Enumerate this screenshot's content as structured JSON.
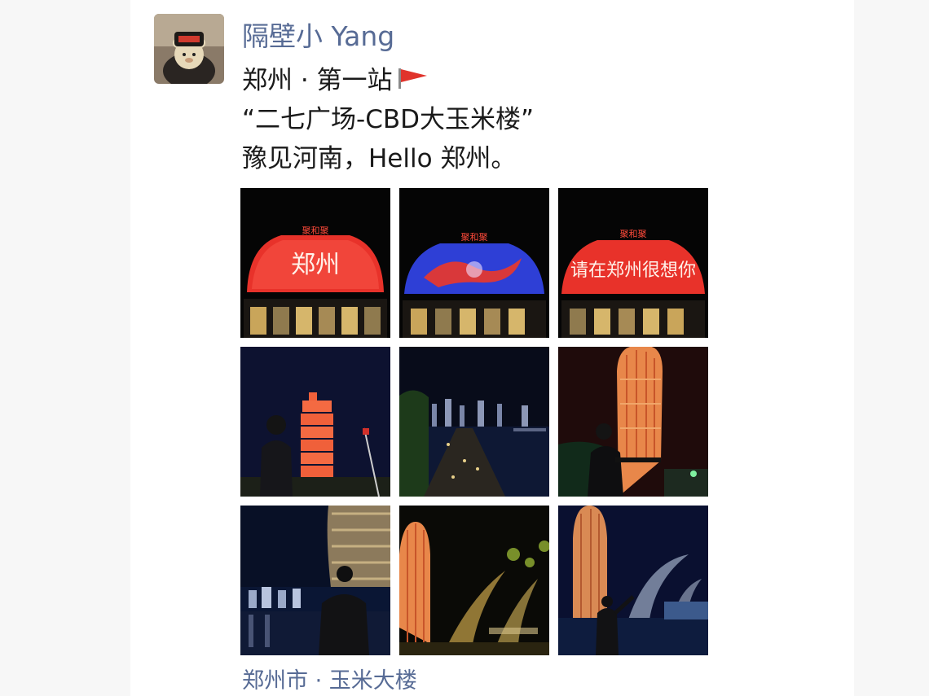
{
  "post": {
    "username": "隔壁小 Yang",
    "text_lines": [
      "郑州 · 第一站",
      "“二七广场-CBD大玉米楼”",
      "豫见河南，Hello 郑州。"
    ],
    "location": "郑州市 · 玉米大楼"
  },
  "photos": [
    {
      "screen_text": "郑州",
      "top_text": "聚和聚"
    },
    {
      "screen_text": "",
      "top_text": "聚和聚"
    },
    {
      "screen_text": "请在郑州很想你",
      "top_text": "聚和聚"
    },
    {
      "screen_text": ""
    },
    {
      "screen_text": ""
    },
    {
      "screen_text": ""
    },
    {
      "screen_text": ""
    },
    {
      "screen_text": ""
    },
    {
      "screen_text": ""
    }
  ],
  "colors": {
    "username": "#576b95",
    "text": "#1a1a1a",
    "flag": "#e0332b",
    "screen_red": "#e8322a",
    "screen_blue": "#2e3fd6"
  }
}
